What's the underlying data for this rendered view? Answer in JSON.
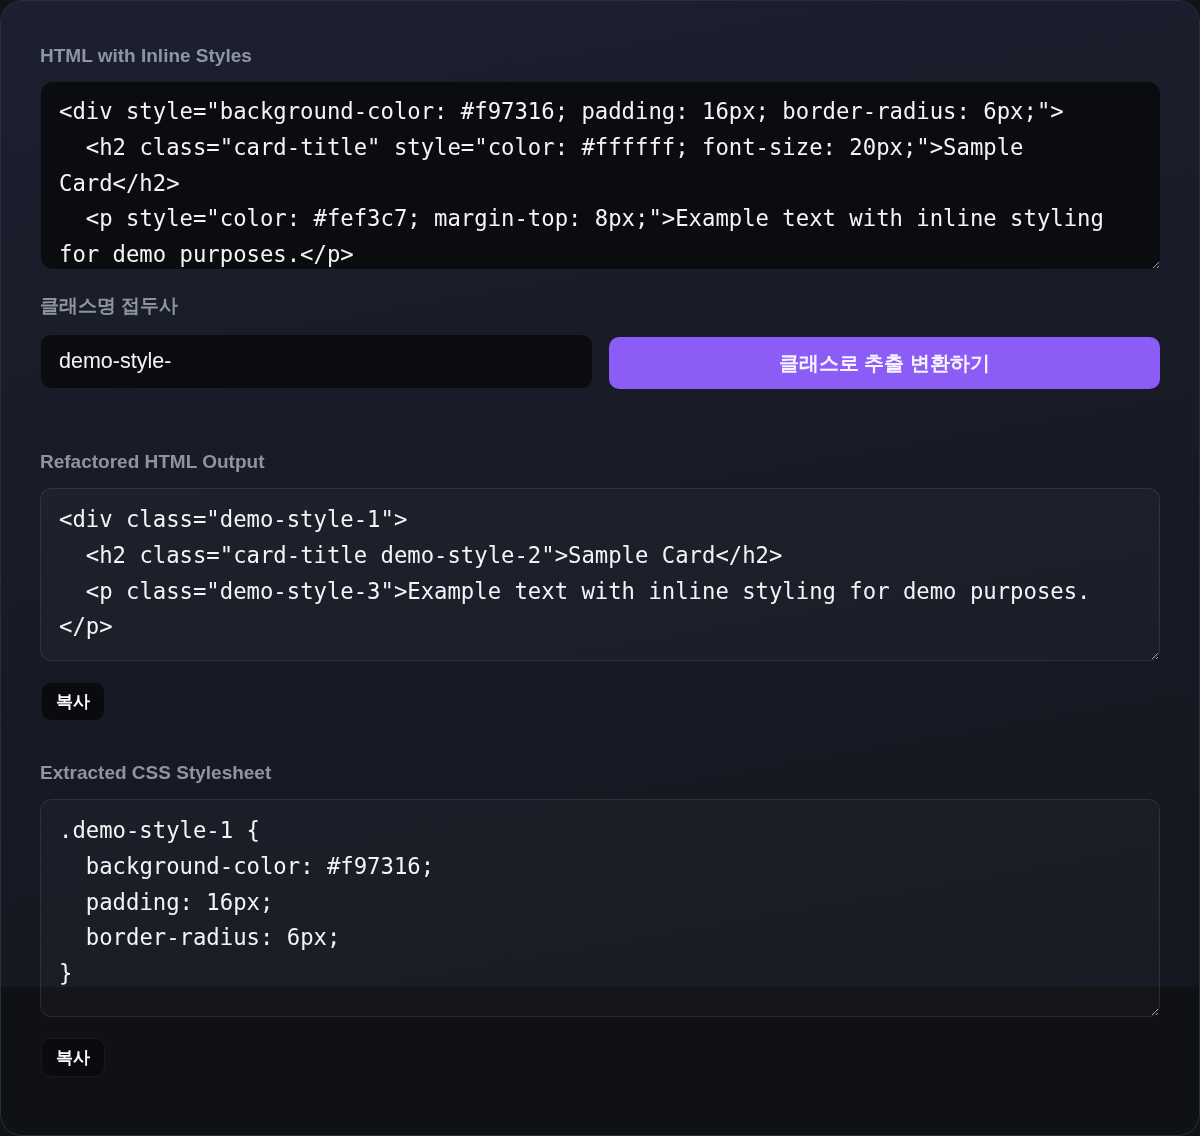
{
  "source": {
    "label": "HTML with Inline Styles",
    "code": "<div style=\"background-color: #f97316; padding: 16px; border-radius: 6px;\">\n  <h2 class=\"card-title\" style=\"color: #ffffff; font-size: 20px;\">Sample Card</h2>\n  <p style=\"color: #fef3c7; margin-top: 8px;\">Example text with inline styling for demo purposes.</p>"
  },
  "prefix": {
    "label": "클래스명 접두사",
    "value": "demo-style-"
  },
  "convert_button": "클래스로 추출 변환하기",
  "outputs": [
    {
      "kind": "html",
      "label": "Refactored HTML Output",
      "code": "<div class=\"demo-style-1\">\n  <h2 class=\"card-title demo-style-2\">Sample Card</h2>\n  <p class=\"demo-style-3\">Example text with inline styling for demo purposes.</p>",
      "copy_button": "복사"
    },
    {
      "kind": "css",
      "label": "Extracted CSS Stylesheet",
      "code": ".demo-style-1 {\n  background-color: #f97316;\n  padding: 16px;\n  border-radius: 6px;\n}",
      "copy_button": "복사"
    }
  ]
}
